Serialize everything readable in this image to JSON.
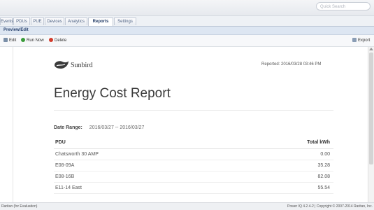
{
  "topbar": {
    "search_placeholder": "Quick Search"
  },
  "tabs": [
    {
      "label": "Events"
    },
    {
      "label": "PDUs"
    },
    {
      "label": "PUE"
    },
    {
      "label": "Devices"
    },
    {
      "label": "Analytics"
    },
    {
      "label": "Reports",
      "active": true
    },
    {
      "label": "Settings"
    }
  ],
  "subhead": {
    "title": "Preview/Edit"
  },
  "toolbar": {
    "edit": "Edit",
    "run_now": "Run Now",
    "delete": "Delete",
    "export": "Export"
  },
  "report": {
    "brand": "Sunbird",
    "reported": "Reported: 2016/03/28 03:46 PM",
    "title": "Energy Cost Report",
    "date_range_label": "Date Range:",
    "date_range_value": "2016/03/27 -- 2016/03/27",
    "columns": [
      "PDU",
      "Total kWh"
    ],
    "rows": [
      [
        "Chatsworth 30 AMP",
        "0.00"
      ],
      [
        "E08-09A",
        "35.28"
      ],
      [
        "E08-16B",
        "82.08"
      ],
      [
        "E11-14 East",
        "55.54"
      ]
    ]
  },
  "footer": {
    "left": "Raritan (for Evaluation)",
    "right": "Power IQ 4.2.4-2 | Copyright © 2007-2014 Raritan, Inc."
  },
  "colors": {
    "accent": "#2b4470",
    "active_tab": "#ffffff"
  }
}
